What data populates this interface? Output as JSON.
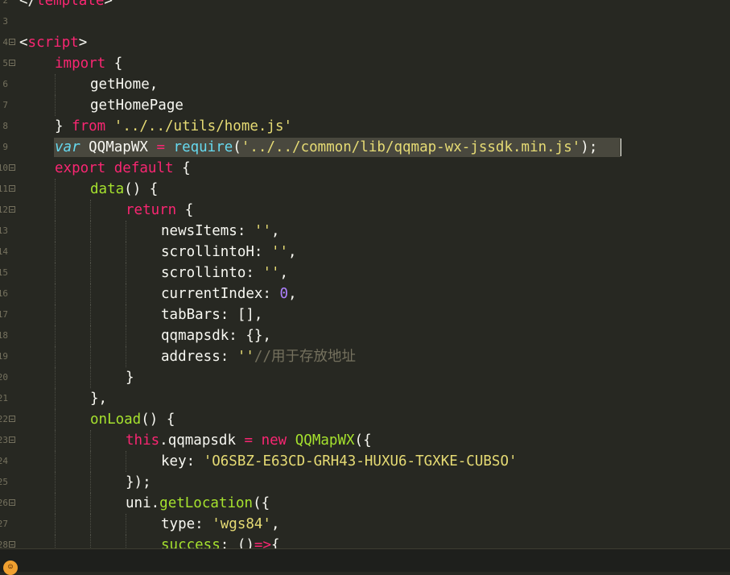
{
  "lines": [
    {
      "num": "2",
      "fold": false,
      "indent": 0,
      "tokens": [
        {
          "c": "plain",
          "t": "</"
        },
        {
          "c": "kw",
          "t": "template"
        },
        {
          "c": "plain",
          "t": ">"
        }
      ]
    },
    {
      "num": "3",
      "fold": false,
      "indent": 0,
      "tokens": []
    },
    {
      "num": "4",
      "fold": true,
      "indent": 0,
      "tokens": [
        {
          "c": "plain",
          "t": "<"
        },
        {
          "c": "kw",
          "t": "script"
        },
        {
          "c": "plain",
          "t": ">"
        }
      ]
    },
    {
      "num": "5",
      "fold": true,
      "indent": 1,
      "tokens": [
        {
          "c": "kw",
          "t": "import"
        },
        {
          "c": "plain",
          "t": " {"
        }
      ]
    },
    {
      "num": "6",
      "fold": false,
      "indent": 2,
      "tokens": [
        {
          "c": "plain",
          "t": "getHome,"
        }
      ]
    },
    {
      "num": "7",
      "fold": false,
      "indent": 2,
      "tokens": [
        {
          "c": "plain",
          "t": "getHomePage"
        }
      ]
    },
    {
      "num": "8",
      "fold": false,
      "indent": 1,
      "tokens": [
        {
          "c": "plain",
          "t": "} "
        },
        {
          "c": "kw",
          "t": "from"
        },
        {
          "c": "plain",
          "t": " "
        },
        {
          "c": "str",
          "t": "'../../utils/home.js'"
        }
      ]
    },
    {
      "num": "9",
      "fold": false,
      "indent": 1,
      "selected": true,
      "tokens": [
        {
          "c": "storage",
          "t": "var"
        },
        {
          "c": "plain",
          "t": " QQMapWX "
        },
        {
          "c": "kw",
          "t": "="
        },
        {
          "c": "plain",
          "t": " "
        },
        {
          "c": "builtin",
          "t": "require"
        },
        {
          "c": "plain",
          "t": "("
        },
        {
          "c": "str",
          "t": "'../../common/lib/qqmap-wx-jssdk.min.js'"
        },
        {
          "c": "plain",
          "t": ");"
        }
      ]
    },
    {
      "num": "10",
      "fold": true,
      "indent": 1,
      "tokens": [
        {
          "c": "kw",
          "t": "export"
        },
        {
          "c": "plain",
          "t": " "
        },
        {
          "c": "kw",
          "t": "default"
        },
        {
          "c": "plain",
          "t": " {"
        }
      ]
    },
    {
      "num": "11",
      "fold": true,
      "indent": 2,
      "tokens": [
        {
          "c": "fn",
          "t": "data"
        },
        {
          "c": "plain",
          "t": "() {"
        }
      ]
    },
    {
      "num": "12",
      "fold": true,
      "indent": 3,
      "tokens": [
        {
          "c": "kw",
          "t": "return"
        },
        {
          "c": "plain",
          "t": " {"
        }
      ]
    },
    {
      "num": "13",
      "fold": false,
      "indent": 4,
      "tokens": [
        {
          "c": "plain",
          "t": "newsItems: "
        },
        {
          "c": "str",
          "t": "''"
        },
        {
          "c": "plain",
          "t": ","
        }
      ]
    },
    {
      "num": "14",
      "fold": false,
      "indent": 4,
      "tokens": [
        {
          "c": "plain",
          "t": "scrollintoH: "
        },
        {
          "c": "str",
          "t": "''"
        },
        {
          "c": "plain",
          "t": ","
        }
      ]
    },
    {
      "num": "15",
      "fold": false,
      "indent": 4,
      "tokens": [
        {
          "c": "plain",
          "t": "scrollinto: "
        },
        {
          "c": "str",
          "t": "''"
        },
        {
          "c": "plain",
          "t": ","
        }
      ]
    },
    {
      "num": "16",
      "fold": false,
      "indent": 4,
      "tokens": [
        {
          "c": "plain",
          "t": "currentIndex: "
        },
        {
          "c": "num",
          "t": "0"
        },
        {
          "c": "plain",
          "t": ","
        }
      ]
    },
    {
      "num": "17",
      "fold": false,
      "indent": 4,
      "tokens": [
        {
          "c": "plain",
          "t": "tabBars: [],"
        }
      ]
    },
    {
      "num": "18",
      "fold": false,
      "indent": 4,
      "tokens": [
        {
          "c": "plain",
          "t": "qqmapsdk: {},"
        }
      ]
    },
    {
      "num": "19",
      "fold": false,
      "indent": 4,
      "tokens": [
        {
          "c": "plain",
          "t": "address: "
        },
        {
          "c": "str",
          "t": "''"
        },
        {
          "c": "cmt",
          "t": "//用于存放地址"
        }
      ]
    },
    {
      "num": "20",
      "fold": false,
      "indent": 3,
      "tokens": [
        {
          "c": "plain",
          "t": "}"
        }
      ]
    },
    {
      "num": "21",
      "fold": false,
      "indent": 2,
      "tokens": [
        {
          "c": "plain",
          "t": "},"
        }
      ]
    },
    {
      "num": "22",
      "fold": true,
      "indent": 2,
      "tokens": [
        {
          "c": "fn",
          "t": "onLoad"
        },
        {
          "c": "plain",
          "t": "() {"
        }
      ]
    },
    {
      "num": "23",
      "fold": true,
      "indent": 3,
      "tokens": [
        {
          "c": "kw",
          "t": "this"
        },
        {
          "c": "plain",
          "t": ".qqmapsdk "
        },
        {
          "c": "kw",
          "t": "="
        },
        {
          "c": "plain",
          "t": " "
        },
        {
          "c": "kw",
          "t": "new"
        },
        {
          "c": "plain",
          "t": " "
        },
        {
          "c": "fn",
          "t": "QQMapWX"
        },
        {
          "c": "plain",
          "t": "({"
        }
      ]
    },
    {
      "num": "24",
      "fold": false,
      "indent": 4,
      "tokens": [
        {
          "c": "plain",
          "t": "key: "
        },
        {
          "c": "str",
          "t": "'O6SBZ-E63CD-GRH43-HUXU6-TGXKE-CUBSO'"
        }
      ]
    },
    {
      "num": "25",
      "fold": false,
      "indent": 3,
      "tokens": [
        {
          "c": "plain",
          "t": "});"
        }
      ]
    },
    {
      "num": "26",
      "fold": true,
      "indent": 3,
      "tokens": [
        {
          "c": "plain",
          "t": "uni."
        },
        {
          "c": "fn",
          "t": "getLocation"
        },
        {
          "c": "plain",
          "t": "({"
        }
      ]
    },
    {
      "num": "27",
      "fold": false,
      "indent": 4,
      "tokens": [
        {
          "c": "plain",
          "t": "type: "
        },
        {
          "c": "str",
          "t": "'wgs84'"
        },
        {
          "c": "plain",
          "t": ","
        }
      ]
    },
    {
      "num": "28",
      "fold": true,
      "indent": 4,
      "tokens": [
        {
          "c": "fn",
          "t": "success"
        },
        {
          "c": "plain",
          "t": ": ()"
        },
        {
          "c": "kw",
          "t": "=>"
        },
        {
          "c": "plain",
          "t": "{"
        }
      ]
    }
  ],
  "statusbar": {
    "icon": "status-icon"
  }
}
